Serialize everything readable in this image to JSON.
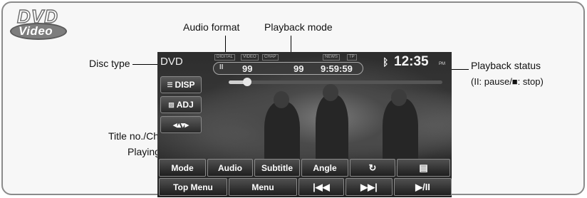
{
  "logo": {
    "line1": "DVD",
    "line2": "Video"
  },
  "annotations": {
    "audio_format": "Audio format",
    "playback_mode": "Playback mode",
    "disc_type": "Disc type",
    "playback_status": "Playback status",
    "playback_status_detail": "(II: pause/■: stop)",
    "title_info_line1": "Title no./Chapter no./",
    "title_info_line2": "Playing time"
  },
  "screen": {
    "disc_type": "DVD",
    "tags": {
      "digital": "DIGITAL",
      "video": "VIDEO",
      "chap": "CHAP",
      "news": "NEWS",
      "tp": "TP"
    },
    "info": {
      "status_icon": "II",
      "title_no": "99",
      "chapter_no": "99",
      "playing_time": "9:59:59"
    },
    "bluetooth_icon": "bluetooth-icon",
    "clock": "12:35",
    "clock_suffix": "PM",
    "progress_fraction": 0.08,
    "side_buttons": {
      "disp": "DISP",
      "adj": "ADJ",
      "move_icon": "move-arrows-icon"
    },
    "row1": {
      "mode": "Mode",
      "audio": "Audio",
      "subtitle": "Subtitle",
      "angle": "Angle",
      "repeat_icon": "repeat-icon",
      "menu_icon": "menu-list-icon"
    },
    "row2": {
      "top_menu": "Top Menu",
      "menu": "Menu",
      "prev": "|◀◀",
      "next": "▶▶|",
      "play_pause": "▶/II"
    }
  }
}
